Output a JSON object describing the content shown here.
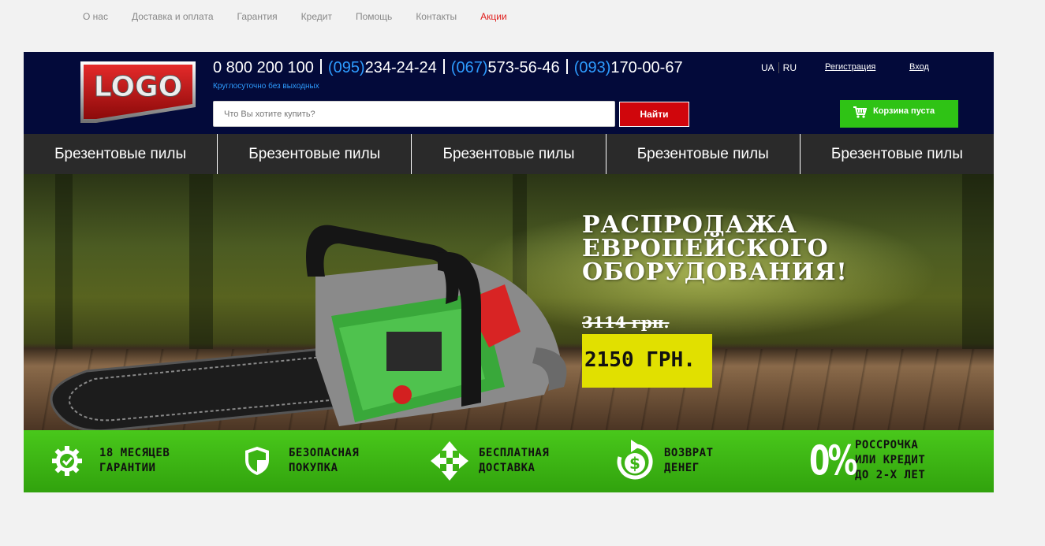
{
  "top_nav": [
    "О нас",
    "Доставка и оплата",
    "Гарантия",
    "Кредит",
    "Помощь",
    "Контакты",
    "Акции"
  ],
  "header": {
    "logo_text": "LOGO",
    "phones": [
      {
        "code": "",
        "number": "0 800 200 100"
      },
      {
        "code": "(095)",
        "number": "234-24-24"
      },
      {
        "code": "(067)",
        "number": "573-56-46"
      },
      {
        "code": "(093)",
        "number": "170-00-67"
      }
    ],
    "hours": "Круглосуточно без выходных",
    "search_placeholder": "Что Вы хотите купить?",
    "search_button": "Найти",
    "lang": [
      "UA",
      "RU"
    ],
    "register": "Регистрация",
    "login": "Вход",
    "cart": "Корзина пуста"
  },
  "categories": [
    "Брезентовые пилы",
    "Брезентовые пилы",
    "Брезентовые пилы",
    "Брезентовые пилы",
    "Брезентовые пилы"
  ],
  "hero": {
    "title_lines": [
      "РАСПРОДАЖА",
      "ЕВРОПЕЙСКОГО",
      "ОБОРУДОВАНИЯ!"
    ],
    "old_price": "3114 грн.",
    "new_price": "2150 ГРН."
  },
  "features": [
    {
      "icon": "gear-check-icon",
      "lines": [
        "18 МЕСЯЦЕВ",
        "ГАРАНТИИ"
      ]
    },
    {
      "icon": "shield-icon",
      "lines": [
        "БЕЗОПАСНАЯ",
        "ПОКУПКА"
      ]
    },
    {
      "icon": "arrows-cross-icon",
      "lines": [
        "БЕСПЛАТНАЯ",
        "ДОСТАВКА"
      ]
    },
    {
      "icon": "money-back-icon",
      "lines": [
        "ВОЗВРАТ",
        "ДЕНЕГ"
      ]
    },
    {
      "icon": "zero-percent-icon",
      "icon_text": "0%",
      "lines": [
        "РОССРОЧКА",
        "ИЛИ КРЕДИТ",
        "ДО 2-Х ЛЕТ"
      ]
    }
  ],
  "colors": {
    "header_bg": "#030a3a",
    "accent_blue": "#2e9cff",
    "search_red": "#d0060c",
    "cart_green": "#2fc315",
    "promo_red": "#e0201e",
    "price_yellow": "#e1e000",
    "features_green": "#3bb414"
  }
}
